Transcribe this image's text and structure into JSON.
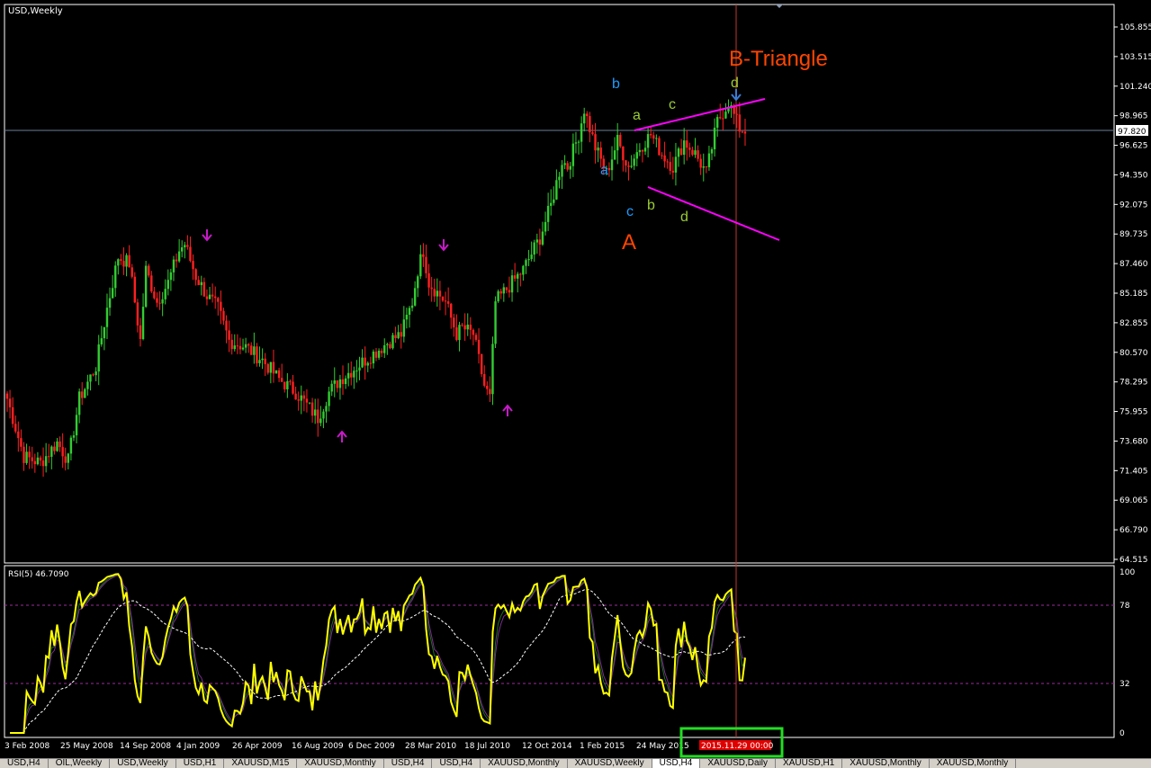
{
  "header": {
    "symbol_label": "USD,Weekly"
  },
  "indicator": {
    "label": "RSI(5) 46.7090"
  },
  "price_axis": {
    "ticks": [
      "105.855",
      "103.515",
      "101.240",
      "98.965",
      "96.625",
      "94.350",
      "92.075",
      "89.735",
      "87.460",
      "85.185",
      "82.855",
      "80.570",
      "78.295",
      "75.955",
      "73.680",
      "71.405",
      "69.065",
      "66.790",
      "64.515"
    ],
    "current_price": "97.820"
  },
  "rsi_axis": {
    "ticks": [
      "100",
      "78",
      "32",
      "0"
    ]
  },
  "time_axis": {
    "labels": [
      "3 Feb 2008",
      "25 May 2008",
      "14 Sep 2008",
      "4 Jan 2009",
      "26 Apr 2009",
      "16 Aug 2009",
      "6 Dec 2009",
      "28 Mar 2010",
      "18 Jul 2010",
      "12 Oct 2014",
      "1 Feb 2015",
      "24 May 2015"
    ],
    "cursor_label": "2015.11.29 00:00"
  },
  "annotations": {
    "title": "B-Triangle",
    "big_a": "A",
    "wave_labels": [
      {
        "text": "b",
        "color": "#1e9bff"
      },
      {
        "text": "a",
        "color": "#1e9bff"
      },
      {
        "text": "c",
        "color": "#1e9bff"
      },
      {
        "text": "a",
        "color": "#9acd32"
      },
      {
        "text": "b",
        "color": "#9acd32"
      },
      {
        "text": "c",
        "color": "#9acd32"
      },
      {
        "text": "d",
        "color": "#9acd32"
      },
      {
        "text": "d",
        "color": "#9acd32"
      }
    ]
  },
  "tabs": [
    "USD,H4",
    "OIL,Weekly",
    "USD,Weekly",
    "USD,H1",
    "XAUUSD,M15",
    "XAUUSD,Monthly",
    "USD,H4",
    "USD,H4",
    "XAUUSD,Monthly",
    "XAUUSD,Weekly",
    "USD,H4",
    "XAUUSD,Daily",
    "XAUUSD,H1",
    "XAUUSD,Monthly",
    "XAUUSD,Monthly"
  ],
  "colors": {
    "up": "#32cd32",
    "down": "#ff2020",
    "rsi": "#ffff00",
    "rsi_ma": "#ffffff",
    "trendline": "#ff00ff",
    "cursor": "#c0392b",
    "title": "#ff4500"
  },
  "chart_data": {
    "type": "candlestick",
    "title": "USD,Weekly",
    "ylim": [
      64.515,
      105.855
    ],
    "anchor_closes": [
      [
        0,
        77.0
      ],
      [
        6,
        72.5
      ],
      [
        12,
        72.0
      ],
      [
        18,
        73.6
      ],
      [
        22,
        72.2
      ],
      [
        26,
        77.0
      ],
      [
        32,
        79.5
      ],
      [
        36,
        84.0
      ],
      [
        40,
        88.0
      ],
      [
        44,
        87.5
      ],
      [
        48,
        81.5
      ],
      [
        50,
        87.0
      ],
      [
        54,
        84.5
      ],
      [
        58,
        86.0
      ],
      [
        62,
        88.5
      ],
      [
        64,
        89.0
      ],
      [
        68,
        86.5
      ],
      [
        72,
        85.0
      ],
      [
        76,
        84.0
      ],
      [
        80,
        81.5
      ],
      [
        86,
        81.0
      ],
      [
        92,
        80.0
      ],
      [
        98,
        78.5
      ],
      [
        104,
        77.5
      ],
      [
        108,
        76.5
      ],
      [
        112,
        75.5
      ],
      [
        116,
        77.5
      ],
      [
        120,
        78.5
      ],
      [
        126,
        79.5
      ],
      [
        132,
        80.5
      ],
      [
        138,
        81.5
      ],
      [
        142,
        82.0
      ],
      [
        146,
        84.5
      ],
      [
        148,
        87.0
      ],
      [
        150,
        88.5
      ],
      [
        152,
        86.0
      ],
      [
        158,
        84.5
      ],
      [
        162,
        82.0
      ],
      [
        164,
        82.5
      ],
      [
        168,
        82.0
      ],
      [
        170,
        80.0
      ],
      [
        172,
        78.0
      ],
      [
        174,
        77.0
      ],
      [
        176,
        84.5
      ],
      [
        180,
        85.5
      ],
      [
        186,
        87.0
      ],
      [
        192,
        89.5
      ],
      [
        196,
        92.0
      ],
      [
        200,
        95.5
      ],
      [
        202,
        95.0
      ],
      [
        206,
        97.5
      ],
      [
        208,
        99.5
      ],
      [
        212,
        96.5
      ],
      [
        216,
        94.5
      ],
      [
        220,
        97.0
      ],
      [
        224,
        95.0
      ],
      [
        228,
        96.5
      ],
      [
        232,
        97.5
      ],
      [
        236,
        96.0
      ],
      [
        240,
        95.0
      ],
      [
        244,
        97.0
      ],
      [
        248,
        96.0
      ],
      [
        252,
        94.5
      ],
      [
        256,
        98.5
      ],
      [
        260,
        100.0
      ],
      [
        264,
        98.0
      ],
      [
        266,
        97.8
      ]
    ],
    "rsi_levels": [
      78,
      32
    ],
    "rsi_last": 46.709,
    "cursor_time": "2015.11.29 00:00"
  }
}
